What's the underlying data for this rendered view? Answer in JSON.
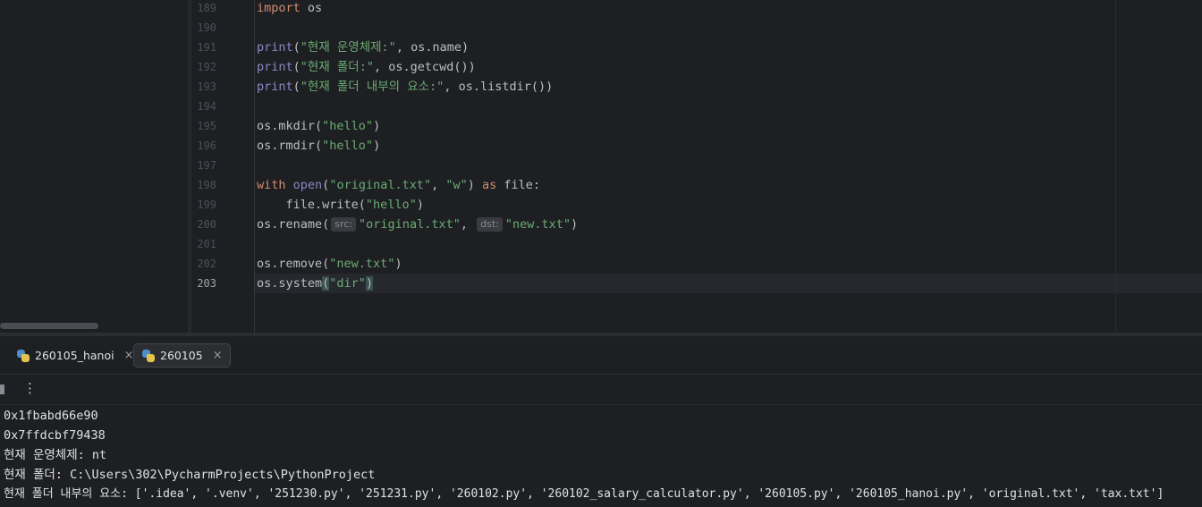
{
  "editor": {
    "line_numbers": [
      "189",
      "190",
      "191",
      "192",
      "193",
      "194",
      "195",
      "196",
      "197",
      "198",
      "199",
      "200",
      "201",
      "202",
      "203"
    ],
    "current_line": "203",
    "code": {
      "l189_kw": "import",
      "l189_rest": " os",
      "l191_fn": "print",
      "l191_a": "(",
      "l191_str": "\"현재 운영체제:\"",
      "l191_b": ", os.name)",
      "l192_fn": "print",
      "l192_a": "(",
      "l192_str": "\"현재 폴더:\"",
      "l192_b": ", os.getcwd())",
      "l193_fn": "print",
      "l193_a": "(",
      "l193_str": "\"현재 폴더 내부의 요소:\"",
      "l193_b": ", os.listdir())",
      "l195_a": "os.mkdir(",
      "l195_str": "\"hello\"",
      "l195_b": ")",
      "l196_a": "os.rmdir(",
      "l196_str": "\"hello\"",
      "l196_b": ")",
      "l198_kw": "with",
      "l198_sp": " ",
      "l198_fn": "open",
      "l198_a": "(",
      "l198_str1": "\"original.txt\"",
      "l198_c": ", ",
      "l198_str2": "\"w\"",
      "l198_d": ") ",
      "l198_kw2": "as",
      "l198_e": " file:",
      "l199_a": "    file.write(",
      "l199_str": "\"hello\"",
      "l199_b": ")",
      "l200_a": "os.rename(",
      "l200_hint1": "src:",
      "l200_str1": "\"original.txt\"",
      "l200_c": ", ",
      "l200_hint2": "dst:",
      "l200_str2": "\"new.txt\"",
      "l200_d": ")",
      "l202_a": "os.remove(",
      "l202_str": "\"new.txt\"",
      "l202_b": ")",
      "l203_a": "os.system",
      "l203_p1": "(",
      "l203_str": "\"dir\"",
      "l203_p2": ")"
    }
  },
  "run_tabs": [
    {
      "label": "260105_hanoi",
      "active": false,
      "close": "×"
    },
    {
      "label": "260105",
      "active": true,
      "close": "×"
    }
  ],
  "toolbar": {
    "more_glyph": "⋮"
  },
  "console": {
    "lines": [
      "0x1fbabd66e90",
      "0x7ffdcbf79438",
      "현재 운영체제: nt",
      "현재 폴더: C:\\Users\\302\\PycharmProjects\\PythonProject",
      "현재 폴더 내부의 요소: ['.idea', '.venv', '251230.py', '251231.py', '260102.py', '260102_salary_calculator.py', '260105.py', '260105_hanoi.py', 'original.txt', 'tax.txt']"
    ]
  },
  "colors": {
    "background": "#1e1f22",
    "keyword": "#cf8e6d",
    "builtin": "#8888c6",
    "string": "#6aab73",
    "text": "#bcbec4"
  }
}
